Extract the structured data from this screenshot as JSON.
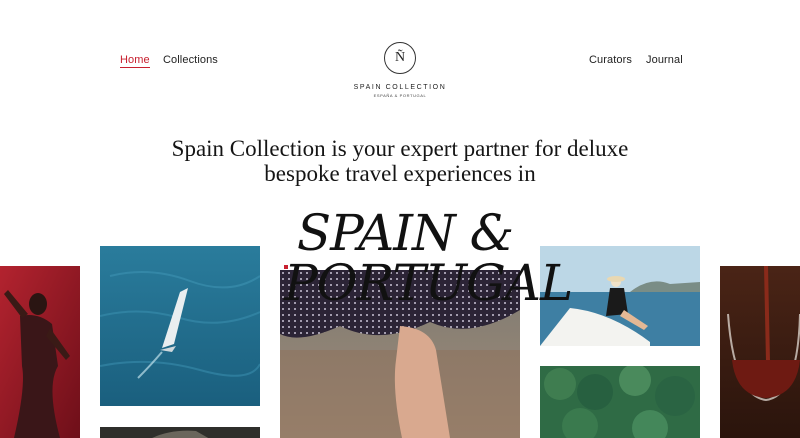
{
  "nav": {
    "left": [
      {
        "label": "Home",
        "active": true
      },
      {
        "label": "Collections",
        "active": false
      }
    ],
    "right": [
      {
        "label": "Curators"
      },
      {
        "label": "Journal"
      }
    ]
  },
  "logo": {
    "monogram": "Ñ",
    "name": "SPAIN COLLECTION",
    "tagline": "ESPAÑA & PORTUGAL"
  },
  "hero": {
    "headline_line1": "Spain Collection is your expert partner for deluxe",
    "headline_line2": "bespoke travel experiences in",
    "title_line1": "SPAIN &",
    "title_line2": "PORTUGAL"
  },
  "colors": {
    "accent": "#c8202f",
    "text": "#1a1a1a",
    "background": "#ffffff"
  }
}
